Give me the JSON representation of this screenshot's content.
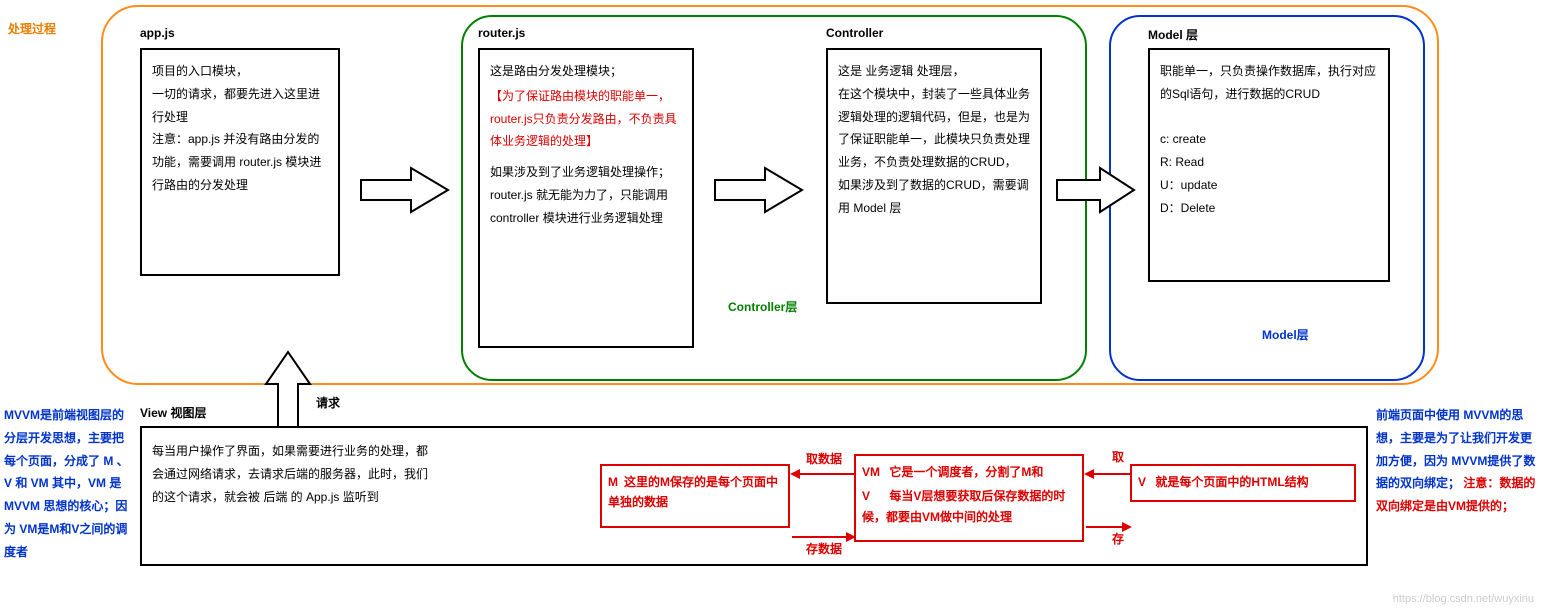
{
  "label_process": "处理过程",
  "outer_orange_note": "",
  "app": {
    "title": "app.js",
    "body": "项目的入口模块，\n一切的请求，都要先进入这里进行处理\n注意：app.js 并没有路由分发的功能，需要调用 router.js 模块进行路由的分发处理"
  },
  "router": {
    "title": "router.js",
    "body1": "这是路由分发处理模块；",
    "body_red": "【为了保证路由模块的职能单一，router.js只负责分发路由，不负责具体业务逻辑的处理】",
    "body2": "如果涉及到了业务逻辑处理操作；router.js 就无能为力了，只能调用 controller 模块进行业务逻辑处理"
  },
  "controller": {
    "title": "Controller",
    "body": "这是 业务逻辑 处理层，\n在这个模块中，封装了一些具体业务逻辑处理的逻辑代码，但是，也是为了保证职能单一，此模块只负责处理业务，不负责处理数据的CRUD，\n如果涉及到了数据的CRUD，需要调用 Model 层",
    "layer_label": "Controller层"
  },
  "model": {
    "title": "Model 层",
    "body": "职能单一，只负责操作数据库，执行对应的Sql语句，进行数据的CRUD\n\nc:  create\nR:  Read\nU：update\nD：Delete",
    "layer_label": "Model层"
  },
  "view": {
    "title": "View 视图层",
    "body": "每当用户操作了界面，如果需要进行业务的处理，都会通过网络请求，去请求后端的服务器，此时，我们的这个请求，就会被 后端 的 App.js 监听到"
  },
  "mvvm_left": "MVVM是前端视图层的分层开发思想，主要把每个页面，分成了 M 、V 和 VM  其中，VM 是 MVVM 思想的核心；因为 VM是M和V之间的调度者",
  "mvvm_right_1": "前端页面中使用 MVVM的思想，主要是为了让我们开发更加方便，因为 MVVM提供了数据的双向绑定；",
  "mvvm_right_red": "注意：数据的双向绑定是由VM提供的；",
  "m_box": {
    "tag": "M",
    "body": "这里的M保存的是每个页面中单独的数据"
  },
  "vm_box": {
    "tag_vm": "VM",
    "tag_v": "V",
    "line1": "它是一个调度者，分割了M和",
    "line2": "每当V层想要获取后保存数据的时候，都要由VM做中间的处理"
  },
  "v_box": {
    "tag": "V",
    "body": "就是每个页面中的HTML结构"
  },
  "arrow_labels": {
    "request": "请求",
    "get_data": "取数据",
    "save_data": "存数据",
    "get": "取",
    "save": "存"
  },
  "watermark": "https://blog.csdn.net/wuyxinu"
}
